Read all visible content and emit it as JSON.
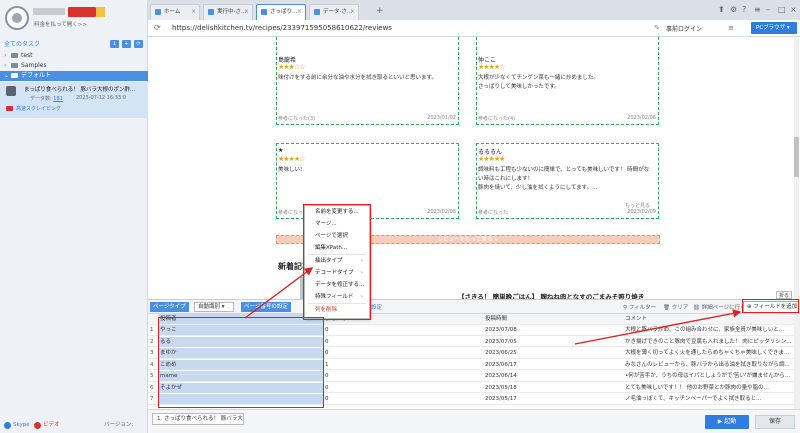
{
  "sidebar": {
    "promo": "料金を払って開く>>",
    "section_title": "全てのタスク",
    "tree": [
      {
        "label": "test",
        "expanded": false
      },
      {
        "label": "Samples",
        "expanded": false
      },
      {
        "label": "デフォルト",
        "expanded": true
      }
    ],
    "task": {
      "title": "まっぱり食べられる！ 豚バラ大根のポン酢...",
      "data_label": "データ数:",
      "data_count": "181",
      "time": "2023-07-12 16:33:0",
      "status": "高速スクレイピング"
    },
    "footer": {
      "skype": "Skype",
      "video": "ビデオ",
      "version": "バージョン: 4.0.1"
    }
  },
  "browser": {
    "tabs": [
      {
        "label": "ホーム",
        "active": false
      },
      {
        "label": "実行中-さ...",
        "active": false
      },
      {
        "label": "さっぱり...",
        "active": true
      },
      {
        "label": "データ-さ...",
        "active": false
      }
    ],
    "url": "https://delishkitchen.tv/recipes/233971595058610622/reviews",
    "login": "事前ログイン",
    "pc_browser": "PCブラウザ"
  },
  "reviews": [
    {
      "name": "島龍希",
      "stars": "★★★☆☆",
      "text": [
        "味付けをする前に余分な油や水分を拭き取るといいと思います。"
      ],
      "helpful": "参考になった(3)",
      "date": "2023/01/02"
    },
    {
      "name": "仲ここ",
      "stars": "★★★★☆",
      "text": [
        "大根が少なくてチンゲン菜も一緒に炒めました。",
        "さっぱりして美味しかったです。"
      ],
      "helpful": "参考になった(4)",
      "date": "2023/02/06"
    },
    {
      "name": "★",
      "stars": "★★★★☆",
      "text": [
        "美味しい!"
      ],
      "helpful": "参考になった",
      "date": "2023/02/08"
    },
    {
      "name": "るるるん",
      "stars": "★★★★★",
      "text": [
        "調味料も工程も少ないのに簡単で、とっても美味しいです！ 時間がな",
        "い時はこれにします！",
        "豚肉を焼いて、少し油を拭くようにしてます。..."
      ],
      "helpful": "参考になった",
      "date": "2023/02/09",
      "more": "もっと見る"
    }
  ],
  "page": {
    "more_reviews": "レビューをもっと見る ∨",
    "new_articles": "新着記事",
    "article_title": "【さきる！ 簡単晩ごはん】 麹ねね肉となすのごまみそ照り焼き"
  },
  "context_menu": {
    "items": [
      {
        "label": "名前を変更する...",
        "sub": false
      },
      {
        "label": "マージ...",
        "sub": false
      },
      {
        "label": "ページで選択",
        "sub": false
      },
      {
        "label": "編集XPath...",
        "sub": false
      },
      {
        "label": "抽出タイプ",
        "sub": true
      },
      {
        "label": "デコードタイプ",
        "sub": true
      },
      {
        "label": "データを修正する...",
        "sub": false
      },
      {
        "label": "特殊フィールド",
        "sub": true
      },
      {
        "label": "列を削除",
        "sub": false,
        "danger": true
      }
    ]
  },
  "panel": {
    "page_type": "ページタイプ",
    "page_type_value": "自動識別",
    "pagination_settings": "ページ番号の設定",
    "mapping_link": "ピング範囲を設定",
    "filter": "フィルター",
    "clear": "クリア",
    "dedup": "詳細ページに行く",
    "add_field": "フィールドを追加",
    "collapse": "折る",
    "columns": [
      "投稿者",
      "参考になった",
      "投稿時間",
      "コメント"
    ],
    "rows": [
      {
        "idx": "1",
        "author": "やっこ",
        "helpful": "0",
        "time": "2023/07/08",
        "comment": "大根と豚バラ炒め、この組み合わせに、家族全員が美味しいと..."
      },
      {
        "idx": "2",
        "author": "るる",
        "helpful": "0",
        "time": "2023/07/05",
        "comment": "かき揚げできのこと豚肉で豆腐も入れました！ 肉にピッタリシン..."
      },
      {
        "idx": "3",
        "author": "まゆか",
        "helpful": "0",
        "time": "2023/06/25",
        "comment": "大根を薄く切ってよく火を通したらめちゃくちゃ美味しくできま..."
      },
      {
        "idx": "4",
        "author": "こめめ",
        "helpful": "1",
        "time": "2023/06/17",
        "comment": "みなさんのレビューから、豚バラから出る油を拭き取りながら調..."
      },
      {
        "idx": "5",
        "author": "mame",
        "helpful": "0",
        "time": "2023/06/14",
        "comment": "•何が苦手か、うちの母はイパとしょうがで'苦い'が嫌ませんから..."
      },
      {
        "idx": "6",
        "author": "そよかぜ",
        "helpful": "0",
        "time": "2023/05/18",
        "comment": "とても美味しいです！！ 他のお野菜とか豚肉の量や脂の..."
      },
      {
        "idx": "7",
        "author": "",
        "helpful": "0",
        "time": "2023/05/17",
        "comment": "ノ毛油っぽくて、キッチンペーパーでよく拭き取ると..."
      }
    ]
  },
  "bottom": {
    "tab": "1. さっぱり食べられる！ 豚バラ大...",
    "start": "起動",
    "save": "保存"
  },
  "colors": {
    "accent": "#2f7de1",
    "highlight": "#e02020",
    "selection": "#c8d9ef"
  }
}
